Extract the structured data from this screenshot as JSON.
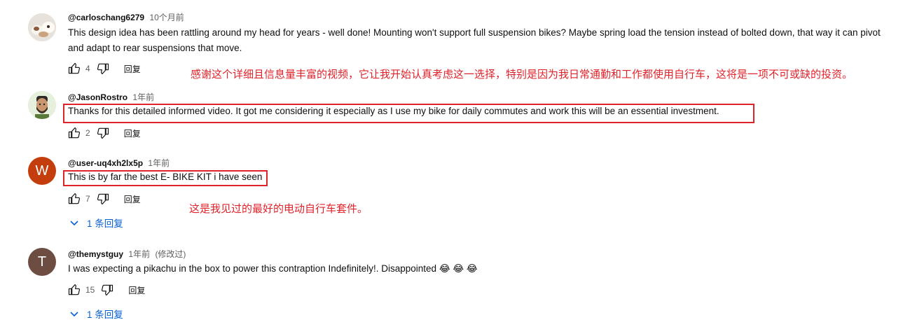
{
  "comments": [
    {
      "author": "@carloschang6279",
      "time": "10个月前",
      "text_line1": "This design idea has been rattling around my head for years - well done! Mounting won't support full suspension bikes? Maybe spring load the tension instead of bolted down, that way it can pivot",
      "text_line2": "and adapt to rear suspensions that move.",
      "likes": "4",
      "reply_label": "回复"
    },
    {
      "author": "@JasonRostro",
      "time": "1年前",
      "text": "Thanks for this detailed informed video. It got me considering it especially as I use my bike for daily commutes and work this will be an essential investment.",
      "likes": "2",
      "reply_label": "回复",
      "avatar_color": "#5a7a3a"
    },
    {
      "author": "@user-uq4xh2lx5p",
      "time": "1年前",
      "text": "This is by far the best E- BIKE KIT i have seen",
      "likes": "7",
      "reply_label": "回复",
      "avatar_letter": "W",
      "avatar_color": "#c43d0c",
      "replies_label": "1 条回复"
    },
    {
      "author": "@themystguy",
      "time": "1年前",
      "edited": "(修改过)",
      "text": "I was expecting a pikachu in the box to power this contraption Indefinitely!. Disappointed 😂 😂 😂",
      "likes": "15",
      "reply_label": "回复",
      "avatar_letter": "T",
      "avatar_color": "#6d4c41",
      "replies_label": "1 条回复"
    }
  ],
  "annotations": {
    "translation_1": "感谢这个详细且信息量丰富的视频，它让我开始认真考虑这一选择，特别是因为我日常通勤和工作都使用自行车，这将是一项不可或缺的投资。",
    "translation_2": "这是我见过的最好的电动自行车套件。",
    "color": "#e0232b"
  },
  "icons": [
    "like-icon",
    "dislike-icon",
    "chevron-down-icon"
  ],
  "colors": {
    "link": "#065fd4",
    "meta": "#606060",
    "text": "#0f0f0f"
  }
}
